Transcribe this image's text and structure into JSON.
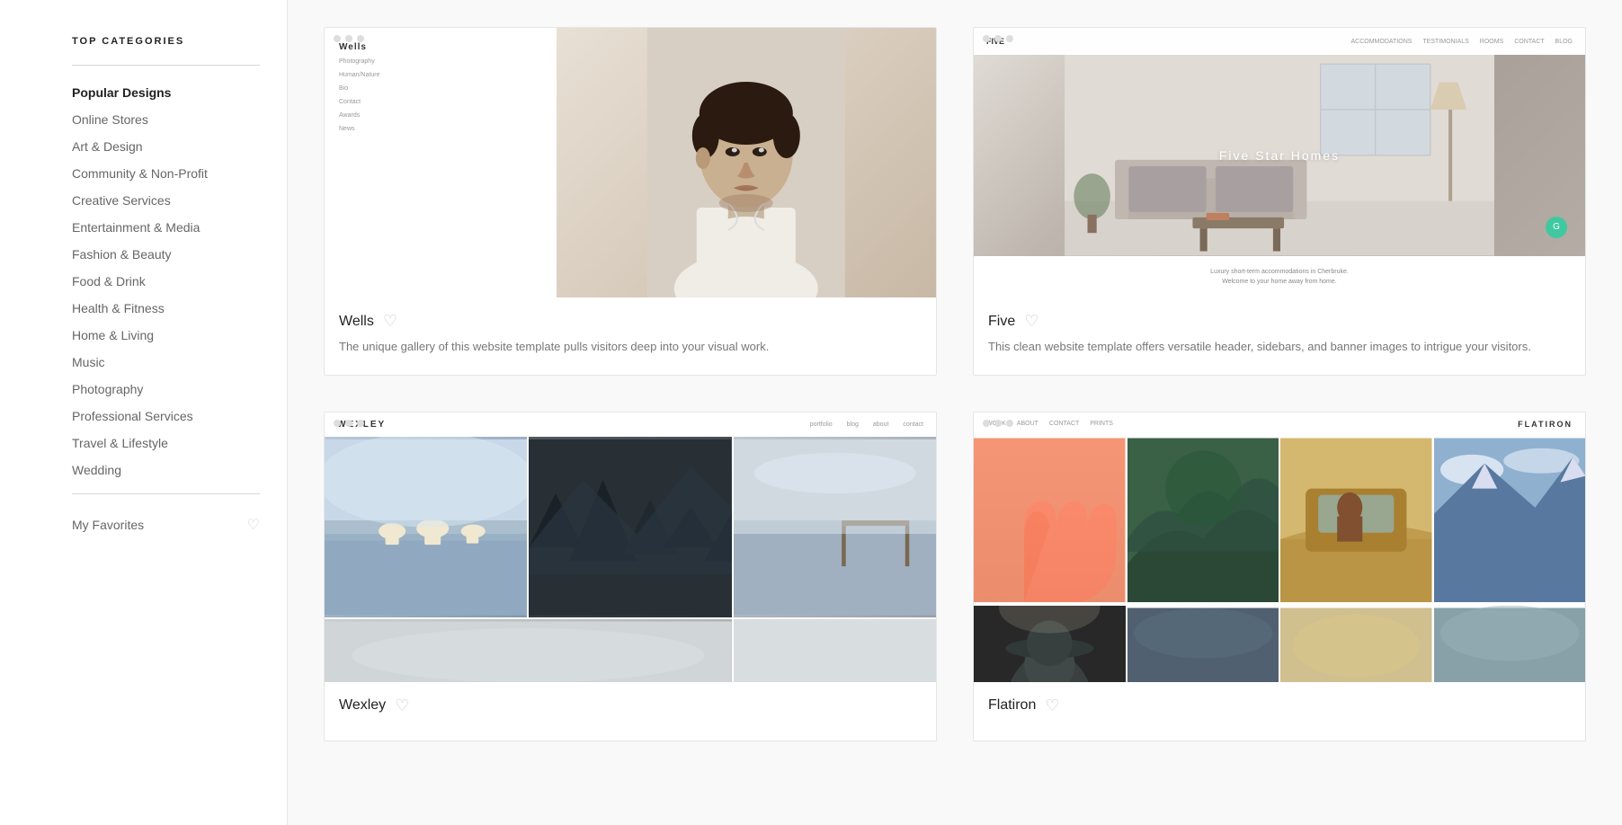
{
  "sidebar": {
    "title": "TOP CATEGORIES",
    "categories": [
      {
        "id": "popular-designs",
        "label": "Popular Designs",
        "active": true
      },
      {
        "id": "online-stores",
        "label": "Online Stores",
        "active": false
      },
      {
        "id": "art-design",
        "label": "Art & Design",
        "active": false
      },
      {
        "id": "community-non-profit",
        "label": "Community & Non-Profit",
        "active": false
      },
      {
        "id": "creative-services",
        "label": "Creative Services",
        "active": false
      },
      {
        "id": "entertainment-media",
        "label": "Entertainment & Media",
        "active": false
      },
      {
        "id": "fashion-beauty",
        "label": "Fashion & Beauty",
        "active": false
      },
      {
        "id": "food-drink",
        "label": "Food & Drink",
        "active": false
      },
      {
        "id": "health-fitness",
        "label": "Health & Fitness",
        "active": false
      },
      {
        "id": "home-living",
        "label": "Home & Living",
        "active": false
      },
      {
        "id": "music",
        "label": "Music",
        "active": false
      },
      {
        "id": "photography",
        "label": "Photography",
        "active": false
      },
      {
        "id": "professional-services",
        "label": "Professional Services",
        "active": false
      },
      {
        "id": "travel-lifestyle",
        "label": "Travel & Lifestyle",
        "active": false
      },
      {
        "id": "wedding",
        "label": "Wedding",
        "active": false
      }
    ],
    "favorites_label": "My Favorites"
  },
  "templates": [
    {
      "id": "wells",
      "name": "Wells",
      "description": "The unique gallery of this website template pulls visitors deep into your visual work.",
      "preview_type": "wells"
    },
    {
      "id": "five",
      "name": "Five",
      "description": "This clean website template offers versatile header, sidebars, and banner images to intrigue your visitors.",
      "preview_type": "five",
      "hero_text": "Five Star Homes",
      "footer_text": "Luxury short-term accommodations in Cherbruke.\nWelcome to your home away from home."
    },
    {
      "id": "wexley",
      "name": "Wexley",
      "description": "",
      "preview_type": "wexley",
      "nav_items": [
        "portfolio",
        "blog",
        "about",
        "contact"
      ]
    },
    {
      "id": "flatiron",
      "name": "Flatiron",
      "description": "",
      "preview_type": "flatiron",
      "nav_items": [
        "work",
        "about",
        "contact",
        "prints"
      ],
      "logo": "FLATIRON"
    }
  ],
  "wells_preview": {
    "site_name": "Wells",
    "nav_items": [
      "Photography",
      "Human/Nature",
      "Bio",
      "Contact",
      "Awards",
      "News"
    ]
  },
  "five_preview": {
    "logo": "FIVE",
    "nav_items": [
      "ACCOMMODATIONS",
      "TESTIMONIALS",
      "ROOMS",
      "CONTACT",
      "BLOG"
    ],
    "hero_text": "Five Star Homes",
    "footer_line1": "Luxury short-term accommodations in Cherbruke.",
    "footer_line2": "Welcome to your home away from home."
  },
  "wexley_preview": {
    "logo": "WEXLEY",
    "nav_items": [
      "portfolio",
      "blog",
      "about",
      "contact"
    ]
  },
  "flatiron_preview": {
    "nav_items": [
      "WORK",
      "ABOUT",
      "CONTACT",
      "PRINTS"
    ],
    "logo": "FLATIRON"
  }
}
